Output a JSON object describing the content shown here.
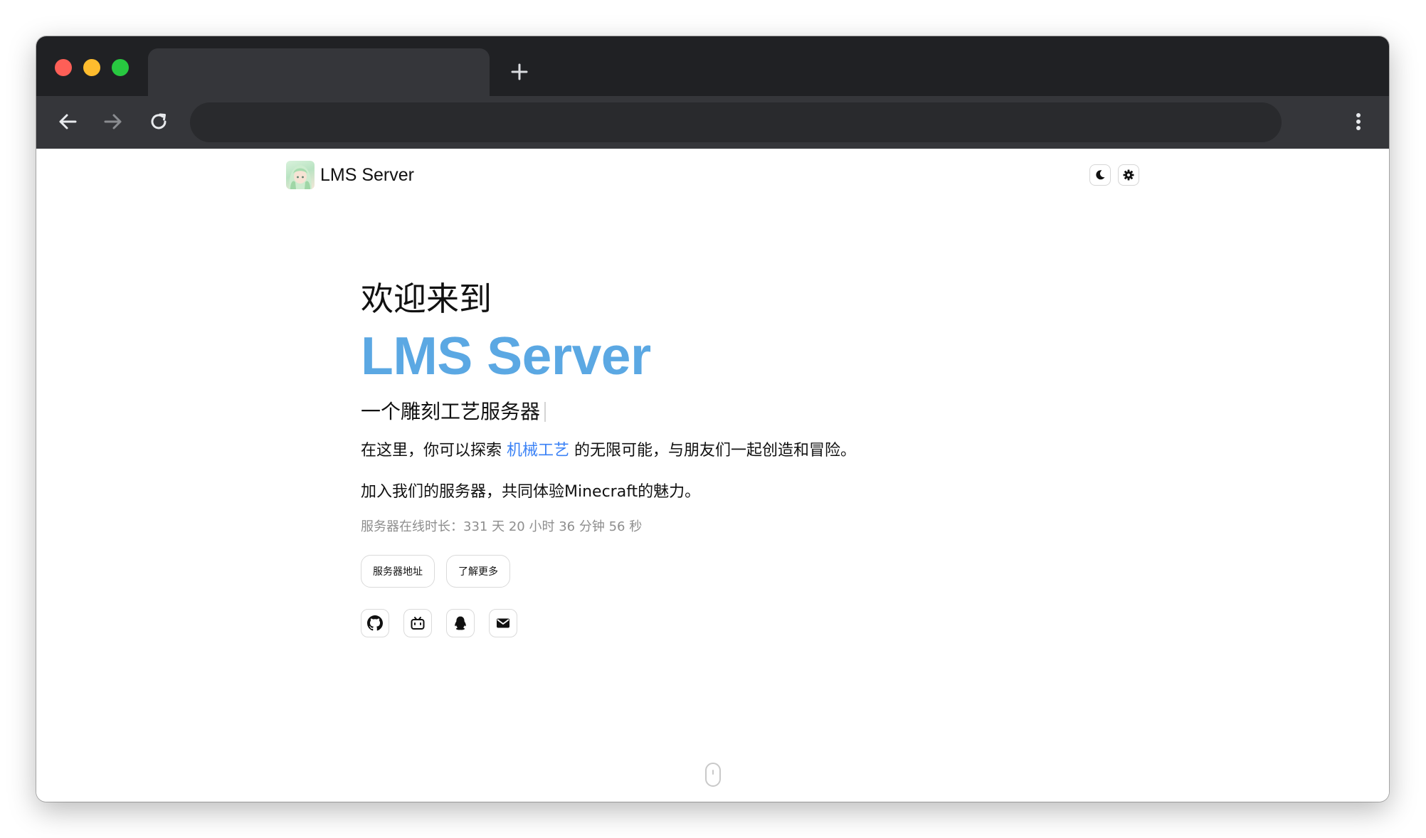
{
  "browser": {
    "tab_title": "",
    "address": "",
    "icons": {
      "new_tab": "plus-icon",
      "back": "arrow-left-icon",
      "forward": "arrow-right-icon",
      "reload": "reload-icon",
      "menu": "kebab-menu-icon"
    }
  },
  "site": {
    "name": "LMS Server",
    "logo": "anime-character-avatar"
  },
  "header_actions": {
    "theme_icon": "moon-icon",
    "settings_icon": "gear-icon"
  },
  "hero": {
    "greeting": "欢迎来到",
    "title": "LMS Server",
    "subtitle": "一个雕刻工艺服务器",
    "desc_before": "在这里，你可以探索 ",
    "desc_link": "机械工艺",
    "desc_after": " 的无限可能，与朋友们一起创造和冒险。",
    "desc2": "加入我们的服务器，共同体验Minecraft的魅力。",
    "uptime": {
      "label": "服务器在线时长：",
      "days": "331",
      "days_unit": "天",
      "hours": "20",
      "hours_unit": "小时",
      "minutes": "36",
      "minutes_unit": "分钟",
      "seconds": "56",
      "seconds_unit": "秒"
    }
  },
  "buttons": {
    "server_address": "服务器地址",
    "learn_more": "了解更多"
  },
  "social": [
    "github-icon",
    "bilibili-icon",
    "qq-icon",
    "mail-icon"
  ],
  "colors": {
    "accent": "#5ba8e3",
    "link": "#3b82f6",
    "muted": "#8e8e8e",
    "browser_dark": "#202124",
    "browser_toolbar": "#35363a"
  }
}
